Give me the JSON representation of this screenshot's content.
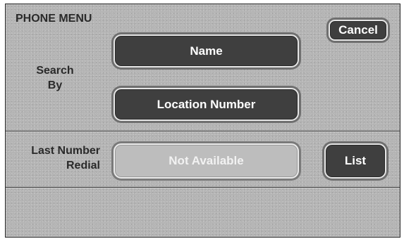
{
  "header": {
    "title": "PHONE MENU",
    "cancel_label": "Cancel"
  },
  "search": {
    "label_line1": "Search",
    "label_line2": "By",
    "name_label": "Name",
    "location_label": "Location Number"
  },
  "redial": {
    "label_line1": "Last Number",
    "label_line2": "Redial",
    "status_label": "Not Available",
    "list_label": "List"
  }
}
